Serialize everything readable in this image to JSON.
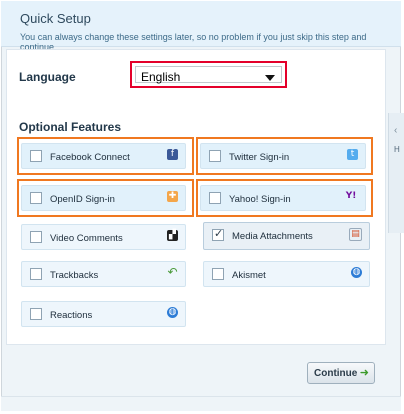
{
  "header": {
    "title": "Quick Setup",
    "subtitle": "You can always change these settings later, so no problem if you just skip this step and continue"
  },
  "language": {
    "label": "Language",
    "selected": "English"
  },
  "features": {
    "title": "Optional Features",
    "items": [
      {
        "label": "Facebook Connect",
        "checked": false,
        "icon": "facebook-icon"
      },
      {
        "label": "Twitter Sign-in",
        "checked": false,
        "icon": "twitter-icon"
      },
      {
        "label": "OpenID Sign-in",
        "checked": false,
        "icon": "openid-icon"
      },
      {
        "label": "Yahoo! Sign-in",
        "checked": false,
        "icon": "yahoo-icon"
      },
      {
        "label": "Video Comments",
        "checked": false,
        "icon": "clapperboard-icon"
      },
      {
        "label": "Media Attachments",
        "checked": true,
        "icon": "media-icon"
      },
      {
        "label": "Trackbacks",
        "checked": false,
        "icon": "undo-arrow-icon"
      },
      {
        "label": "Akismet",
        "checked": false,
        "icon": "globe-icon"
      },
      {
        "label": "Reactions",
        "checked": false,
        "icon": "globe-icon"
      }
    ]
  },
  "icons": {
    "facebook": "f",
    "twitter": "t",
    "openid": "✚",
    "yahoo": "Y!",
    "video": "▞",
    "media": "▤",
    "trackback": "↶",
    "globe": "◍"
  },
  "side": {
    "chevron": "‹",
    "letter": "H"
  },
  "continue_label": "Continue",
  "continue_arrow": "➜",
  "colors": {
    "highlight_orange": "#f07820",
    "highlight_red": "#e4002b",
    "feature_bg": "#e1f1fb"
  }
}
